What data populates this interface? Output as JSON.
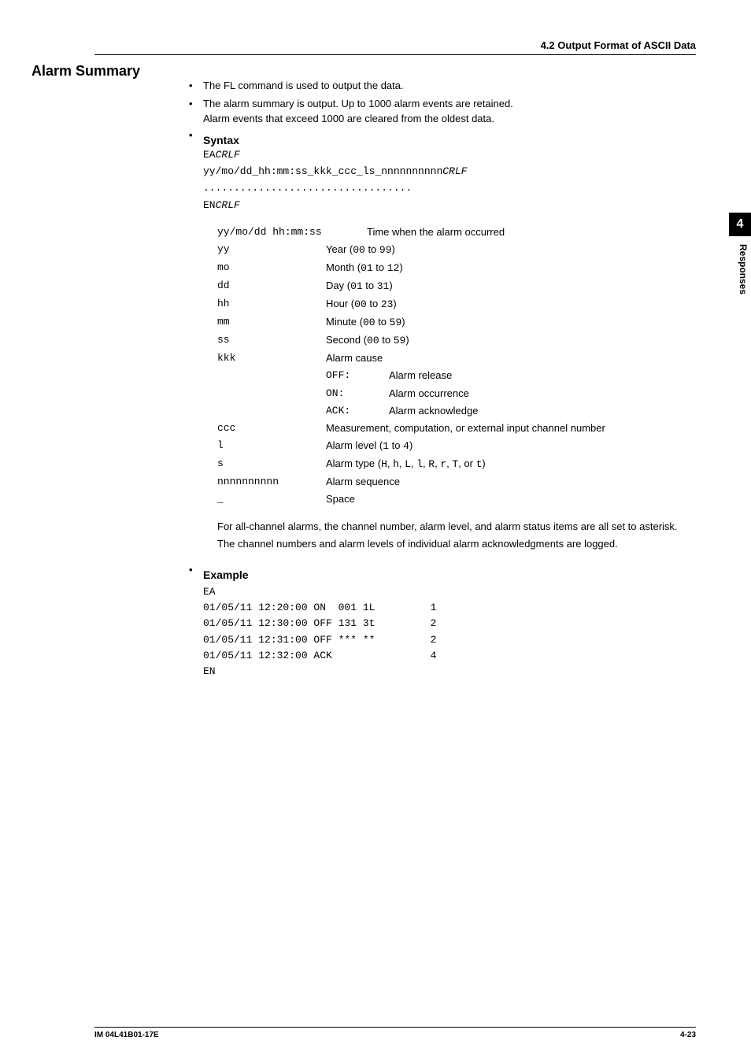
{
  "header": {
    "section": "4.2  Output Format of ASCII Data"
  },
  "title": "Alarm Summary",
  "bullets": [
    "The FL command is used to output the data.",
    "The alarm summary is output.  Up to 1000 alarm events are retained.\nAlarm events that exceed 1000 are cleared from the oldest data."
  ],
  "syntax": {
    "heading": "Syntax",
    "lines": {
      "l1a": "EA",
      "l1b": "CRLF",
      "l2a": "yy/mo/dd_hh:mm:ss_kkk_ccc_ls_nnnnnnnnnn",
      "l2b": "CRLF",
      "dots": "..................................",
      "l3a": "EN",
      "l3b": "CRLF"
    }
  },
  "defs": [
    {
      "key": "yy/mo/dd hh:mm:ss",
      "val": "Time when the alarm occurred",
      "wide": true
    },
    {
      "key": "yy",
      "preval": "Year (",
      "code": "00",
      "mid": " to ",
      "code2": "99",
      "post": ")"
    },
    {
      "key": "mo",
      "preval": "Month (",
      "code": "01",
      "mid": " to ",
      "code2": "12",
      "post": ")"
    },
    {
      "key": "dd",
      "preval": "Day (",
      "code": "01",
      "mid": " to ",
      "code2": "31",
      "post": ")"
    },
    {
      "key": "hh",
      "preval": "Hour (",
      "code": "00",
      "mid": " to ",
      "code2": "23",
      "post": ")"
    },
    {
      "key": "mm",
      "preval": "Minute (",
      "code": "00",
      "mid": " to ",
      "code2": "59",
      "post": ")"
    },
    {
      "key": "ss",
      "preval": "Second (",
      "code": "00",
      "mid": " to ",
      "code2": "59",
      "post": ")"
    },
    {
      "key": "kkk",
      "val": "Alarm cause"
    }
  ],
  "kkk_sub": [
    {
      "k": "OFF:",
      "v": "Alarm release"
    },
    {
      "k": "ON:",
      "v": "Alarm occurrence"
    },
    {
      "k": "ACK:",
      "v": "Alarm acknowledge"
    }
  ],
  "defs2": [
    {
      "key": "ccc",
      "val": "Measurement, computation, or external input channel number"
    },
    {
      "key": "l",
      "preval": "Alarm level (",
      "code": "1",
      "mid": " to ",
      "code2": "4",
      "post": ")"
    },
    {
      "key": "s",
      "preval": "Alarm type (",
      "code": "H",
      "mid1": ", ",
      "code2": "h",
      "mid2": ", ",
      "code3": "L",
      "mid3": ", ",
      "code4": "l",
      "mid4": ", ",
      "code5": "R",
      "mid5": ", ",
      "code6": "r",
      "mid6": ", ",
      "code7": "T",
      "mid7": ", or ",
      "code8": "t",
      "post": ")"
    },
    {
      "key": "nnnnnnnnnn",
      "val": "Alarm sequence"
    },
    {
      "key": "_",
      "val": "Space"
    }
  ],
  "para1": "For all-channel alarms, the channel number, alarm level, and alarm status items are all set to asterisk.",
  "para2": "The channel numbers and alarm levels of individual alarm acknowledgments are logged.",
  "example": {
    "heading": "Example",
    "text": "EA\n01/05/11 12:20:00 ON  001 1L         1\n01/05/11 12:30:00 OFF 131 3t         2\n01/05/11 12:31:00 OFF *** **         2\n01/05/11 12:32:00 ACK                4\nEN"
  },
  "side": {
    "num": "4",
    "label": "Responses"
  },
  "footer": {
    "left": "IM 04L41B01-17E",
    "right": "4-23"
  }
}
